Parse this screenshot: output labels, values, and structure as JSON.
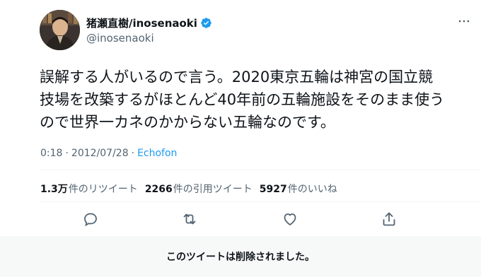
{
  "author": {
    "display_name": "猪瀬直樹/inosenaoki",
    "handle": "@inosenaoki",
    "verified_icon": "verified-badge-icon",
    "more_icon": "more-icon"
  },
  "tweet": {
    "lines": [
      "誤解する人がいるので言う。2020東京五輪は神宮の国立競",
      "技場を改築するがほとんど40年前の五輪施設をそのまま使う",
      "ので世界一カネのかからない五輪なのです。"
    ]
  },
  "meta": {
    "time": "0:18",
    "sep1": "·",
    "date": "2012/07/28",
    "sep2": "·",
    "source": "Echofon"
  },
  "stats": {
    "retweets_count": "1.3万",
    "retweets_label": "件のリツイート",
    "quotes_count": "2266",
    "quotes_label": "件の引用ツイート",
    "likes_count": "5927",
    "likes_label": "件のいいね"
  },
  "actions": {
    "reply_icon": "reply-icon",
    "retweet_icon": "retweet-icon",
    "like_icon": "heart-icon",
    "share_icon": "share-icon"
  },
  "notice": {
    "deleted_text": "このツイートは削除されました。"
  },
  "colors": {
    "accent": "#1d9bf0",
    "text": "#0f1419",
    "secondary": "#536471",
    "notice_bg": "#f7f9f9"
  }
}
